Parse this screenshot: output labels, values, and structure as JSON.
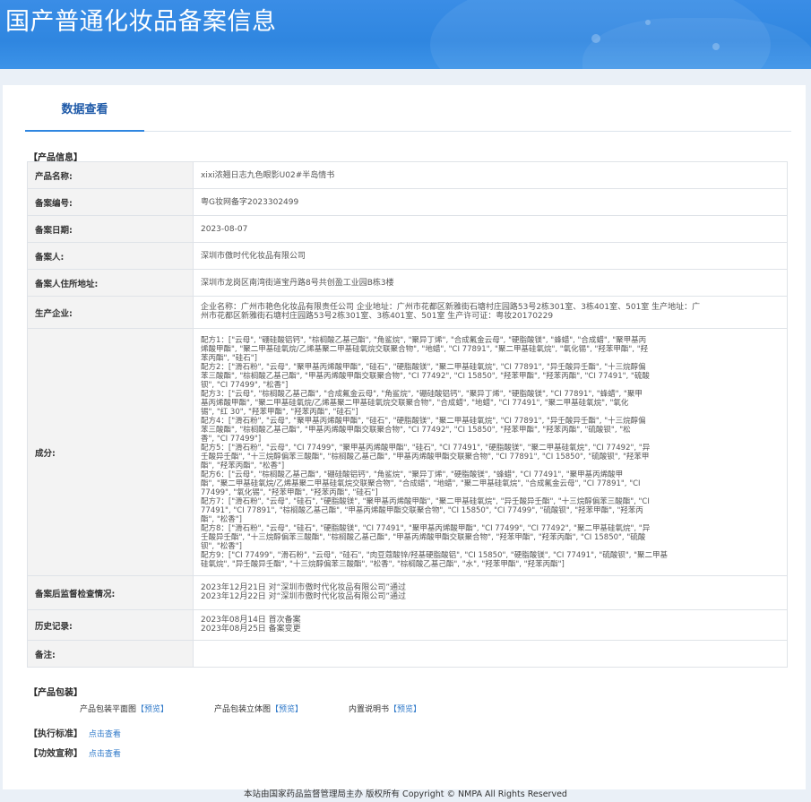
{
  "banner": {
    "title": "国产普通化妆品备案信息"
  },
  "tabs": [
    {
      "label": "数据查看"
    }
  ],
  "product_section_title": "【产品信息】",
  "fields": {
    "name": {
      "label": "产品名称:",
      "value": "xixi浓翘日志九色眼影U02#半岛情书"
    },
    "record_no": {
      "label": "备案编号:",
      "value": "粤G妆网备字2023302499"
    },
    "record_date": {
      "label": "备案日期:",
      "value": "2023-08-07"
    },
    "registrant": {
      "label": "备案人:",
      "value": "深圳市傲时代化妆品有限公司"
    },
    "address": {
      "label": "备案人住所地址:",
      "value": "深圳市龙岗区南湾街道宝丹路8号共创盈工业园B栋3楼"
    },
    "manufacturer": {
      "label": "生产企业:",
      "lines": [
        "企业名称：广州市艳色化妆品有限责任公司 企业地址：广州市花都区新雅街石塘村庄园路53号2栋301室、3栋401室、501室 生产地址：广",
        "州市花都区新雅街石塘村庄园路53号2栋301室、3栋401室、501室 生产许可证：粤妆20170229"
      ]
    },
    "ingredients": {
      "label": "成分:",
      "lines": [
        "配方1：[\"云母\", \"硼硅酸铝钙\", \"棕榈酸乙基己酯\", \"角鲨烷\", \"聚异丁烯\", \"合成氟金云母\", \"硬脂酸镁\", \"蜂蜡\", \"合成蜡\", \"聚甲基丙",
        "烯酸甲酯\", \"聚二甲基硅氧烷/乙烯基聚二甲基硅氧烷交联聚合物\", \"地蜡\", \"CI 77891\", \"聚二甲基硅氧烷\", \"氧化锡\", \"羟苯甲酯\", \"羟",
        "苯丙酯\", \"硅石\"]",
        "配方2：[\"滑石粉\", \"云母\", \"聚甲基丙烯酸甲酯\", \"硅石\", \"硬脂酸镁\", \"聚二甲基硅氧烷\", \"CI 77891\", \"异壬酸异壬酯\", \"十三烷醇偏",
        "苯三酸酯\", \"棕榈酸乙基己酯\", \"甲基丙烯酸甲酯交联聚合物\", \"CI 77492\", \"CI 15850\", \"羟苯甲酯\", \"羟苯丙酯\", \"CI 77491\", \"硫酸",
        "钡\", \"CI 77499\", \"松香\"]",
        "配方3：[\"云母\", \"棕榈酸乙基己酯\", \"合成氟金云母\", \"角鲨烷\", \"硼硅酸铝钙\", \"聚异丁烯\", \"硬脂酸镁\", \"CI 77891\", \"蜂蜡\", \"聚甲",
        "基丙烯酸甲酯\", \"聚二甲基硅氧烷/乙烯基聚二甲基硅氧烷交联聚合物\", \"合成蜡\", \"地蜡\", \"CI 77491\", \"聚二甲基硅氧烷\", \"氧化",
        "锡\", \"红 30\", \"羟苯甲酯\", \"羟苯丙酯\", \"硅石\"]",
        "配方4：[\"滑石粉\", \"云母\", \"聚甲基丙烯酸甲酯\", \"硅石\", \"硬脂酸镁\", \"聚二甲基硅氧烷\", \"CI 77891\", \"异壬酸异壬酯\", \"十三烷醇偏",
        "苯三酸酯\", \"棕榈酸乙基己酯\", \"甲基丙烯酸甲酯交联聚合物\", \"CI 77492\", \"CI 15850\", \"羟苯甲酯\", \"羟苯丙酯\", \"硫酸钡\", \"松",
        "香\", \"CI 77499\"]",
        "配方5：[\"滑石粉\", \"云母\", \"CI 77499\", \"聚甲基丙烯酸甲酯\", \"硅石\", \"CI 77491\", \"硬脂酸镁\", \"聚二甲基硅氧烷\", \"CI 77492\", \"异",
        "壬酸异壬酯\", \"十三烷醇偏苯三酸酯\", \"棕榈酸乙基己酯\", \"甲基丙烯酸甲酯交联聚合物\", \"CI 77891\", \"CI 15850\", \"硫酸钡\", \"羟苯甲",
        "酯\", \"羟苯丙酯\", \"松香\"]",
        "配方6：[\"云母\", \"棕榈酸乙基己酯\", \"硼硅酸铝钙\", \"角鲨烷\", \"聚异丁烯\", \"硬脂酸镁\", \"蜂蜡\", \"CI 77491\", \"聚甲基丙烯酸甲",
        "酯\", \"聚二甲基硅氧烷/乙烯基聚二甲基硅氧烷交联聚合物\", \"合成蜡\", \"地蜡\", \"聚二甲基硅氧烷\", \"合成氟金云母\", \"CI 77891\", \"CI",
        "77499\", \"氧化锡\", \"羟苯甲酯\", \"羟苯丙酯\", \"硅石\"]",
        "配方7：[\"滑石粉\", \"云母\", \"硅石\", \"硬脂酸镁\", \"聚甲基丙烯酸甲酯\", \"聚二甲基硅氧烷\", \"异壬酸异壬酯\", \"十三烷醇偏苯三酸酯\", \"CI",
        "77491\", \"CI 77891\", \"棕榈酸乙基己酯\", \"甲基丙烯酸甲酯交联聚合物\", \"CI 15850\", \"CI 77499\", \"硫酸钡\", \"羟苯甲酯\", \"羟苯丙",
        "酯\", \"松香\"]",
        "配方8：[\"滑石粉\", \"云母\", \"硅石\", \"硬脂酸镁\", \"CI 77491\", \"聚甲基丙烯酸甲酯\", \"CI 77499\", \"CI 77492\", \"聚二甲基硅氧烷\", \"异",
        "壬酸异壬酯\", \"十三烷醇偏苯三酸酯\", \"棕榈酸乙基己酯\", \"甲基丙烯酸甲酯交联聚合物\", \"羟苯甲酯\", \"羟苯丙酯\", \"CI 15850\", \"硫酸",
        "钡\", \"松香\"]",
        "配方9：[\"CI 77499\", \"滑石粉\", \"云母\", \"硅石\", \"肉豆蔻酸锌/羟基硬脂酸铝\", \"CI 15850\", \"硬脂酸镁\", \"CI 77491\", \"硫酸钡\", \"聚二甲基",
        "硅氧烷\", \"异壬酸异壬酯\", \"十三烷醇偏苯三酸酯\", \"松香\", \"棕榈酸乙基己酯\", \"水\", \"羟苯甲酯\", \"羟苯丙酯\"]"
      ]
    },
    "inspection": {
      "label": "备案后监督检查情况:",
      "lines": [
        "2023年12月21日 对“深圳市傲时代化妆品有限公司”通过",
        "2023年12月22日 对“深圳市傲时代化妆品有限公司”通过"
      ]
    },
    "history": {
      "label": "历史记录:",
      "lines": [
        "2023年08月14日 首次备案",
        "2023年08月25日 备案变更"
      ]
    },
    "remarks": {
      "label": "备注:",
      "value": ""
    }
  },
  "packaging": {
    "title": "【产品包装】",
    "items": [
      {
        "label": "产品包装平面图",
        "link": "【预览】"
      },
      {
        "label": "产品包装立体图",
        "link": "【预览】"
      },
      {
        "label": "内置说明书",
        "link": "【预览】"
      }
    ]
  },
  "standard": {
    "title": "【执行标准】",
    "link": "点击查看"
  },
  "efficacy": {
    "title": "【功效宣称】",
    "link": "点击查看"
  },
  "footer": {
    "text": "本站由国家药品监督管理局主办 版权所有 Copyright © NMPA All Rights Reserved"
  }
}
